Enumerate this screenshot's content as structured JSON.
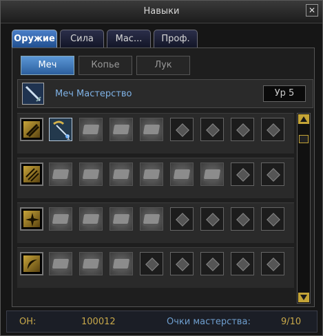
{
  "window": {
    "title": "Навыки",
    "close_glyph": "✕"
  },
  "tabs": [
    {
      "label": "Оружие",
      "active": true
    },
    {
      "label": "Сила",
      "active": false
    },
    {
      "label": "Мас...",
      "active": false
    },
    {
      "label": "Проф.",
      "active": false
    }
  ],
  "subtabs": [
    {
      "label": "Меч",
      "active": true
    },
    {
      "label": "Копье",
      "active": false
    },
    {
      "label": "Лук",
      "active": false
    }
  ],
  "mastery": {
    "name": "Меч Мастерство",
    "level": "Ур 5",
    "icon": "sword-icon"
  },
  "skill_rows": [
    {
      "category_icon": "claw-slash-icon",
      "slots": [
        "learned",
        "book",
        "book",
        "book",
        "locked",
        "locked",
        "locked",
        "locked"
      ],
      "learned_count": "1"
    },
    {
      "category_icon": "multi-slash-icon",
      "slots": [
        "book",
        "book",
        "book",
        "book",
        "book",
        "book",
        "locked",
        "locked"
      ]
    },
    {
      "category_icon": "burst-icon",
      "slots": [
        "book",
        "book",
        "book",
        "book",
        "locked",
        "locked",
        "locked",
        "locked"
      ]
    },
    {
      "category_icon": "crescent-slash-icon",
      "slots": [
        "book",
        "book",
        "book",
        "locked",
        "locked",
        "locked",
        "locked",
        "locked"
      ]
    }
  ],
  "footer": {
    "points_label": "ОН:",
    "points_value": "100012",
    "mastery_points_label": "Очки мастерства:",
    "mastery_points_value": "9/10"
  },
  "colors": {
    "accent_blue": "#4a7fc8",
    "gold": "#c9a94a"
  }
}
